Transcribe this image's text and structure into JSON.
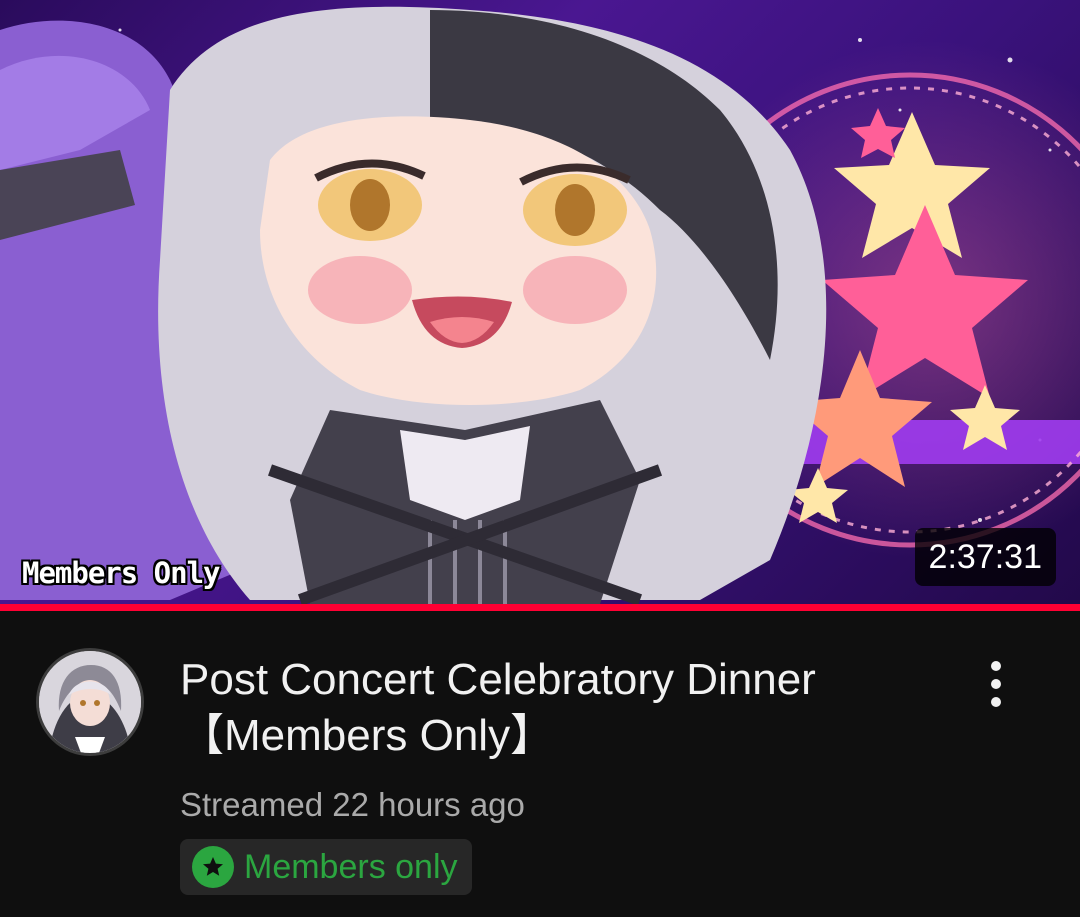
{
  "thumbnail": {
    "stamp_text": "Members Only",
    "duration": "2:37:31",
    "watched_fraction": 1.0
  },
  "video": {
    "title_line1": "Post Concert Celebratory Dinner",
    "title_line2": "【Members Only】",
    "metadata": "Streamed 22 hours ago",
    "badge_label": "Members only"
  },
  "colors": {
    "accent_progress": "#ff0033",
    "members_green": "#2ba640",
    "background": "#0f0f0f"
  },
  "icons": {
    "more": "more-vertical-icon",
    "badge": "star-badge-icon"
  }
}
